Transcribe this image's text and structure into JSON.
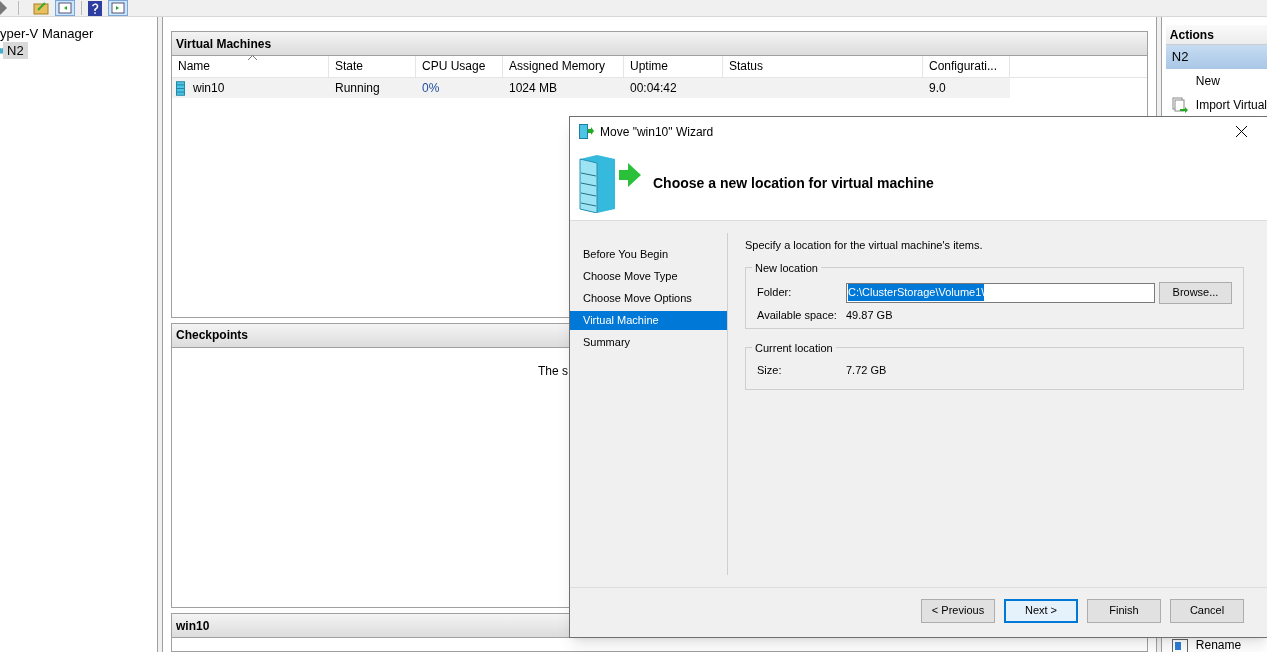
{
  "tree": {
    "root": "yper-V Manager",
    "children": [
      {
        "label": "N2",
        "selected": true
      }
    ]
  },
  "vm_panel": {
    "title": "Virtual Machines",
    "columns": [
      "Name",
      "State",
      "CPU Usage",
      "Assigned Memory",
      "Uptime",
      "Status",
      "Configurati..."
    ],
    "rows": [
      {
        "cells": [
          "win10",
          "Running",
          "0%",
          "1024 MB",
          "00:04:42",
          "",
          "9.0"
        ],
        "selected": false
      }
    ]
  },
  "checkpoints_panel": {
    "title": "Checkpoints",
    "message": "The s"
  },
  "details_panel": {
    "title": "win10"
  },
  "actions": {
    "title": "Actions",
    "group": "N2",
    "items": [
      "New",
      "Import Virtual",
      "Rename"
    ]
  },
  "wizard": {
    "title": "Move \"win10\" Wizard",
    "heading": "Choose a new location for virtual machine",
    "steps": [
      {
        "label": "Before You Begin",
        "selected": false
      },
      {
        "label": "Choose Move Type",
        "selected": false
      },
      {
        "label": "Choose Move Options",
        "selected": false
      },
      {
        "label": "Virtual Machine",
        "selected": true
      },
      {
        "label": "Summary",
        "selected": false
      }
    ],
    "intro": "Specify a location for the virtual machine's items.",
    "new_location": {
      "legend": "New location",
      "folder_label": "Folder:",
      "folder_value": "C:\\ClusterStorage\\Volume1\\",
      "browse": "Browse...",
      "space_label": "Available space:",
      "space_value": "49.87 GB"
    },
    "current_location": {
      "legend": "Current location",
      "size_label": "Size:",
      "size_value": "7.72 GB"
    },
    "buttons": [
      {
        "label": "< Previous",
        "focused": false
      },
      {
        "label": "Next >",
        "focused": true
      },
      {
        "label": "Finish",
        "focused": false
      },
      {
        "label": "Cancel",
        "focused": false
      }
    ]
  }
}
